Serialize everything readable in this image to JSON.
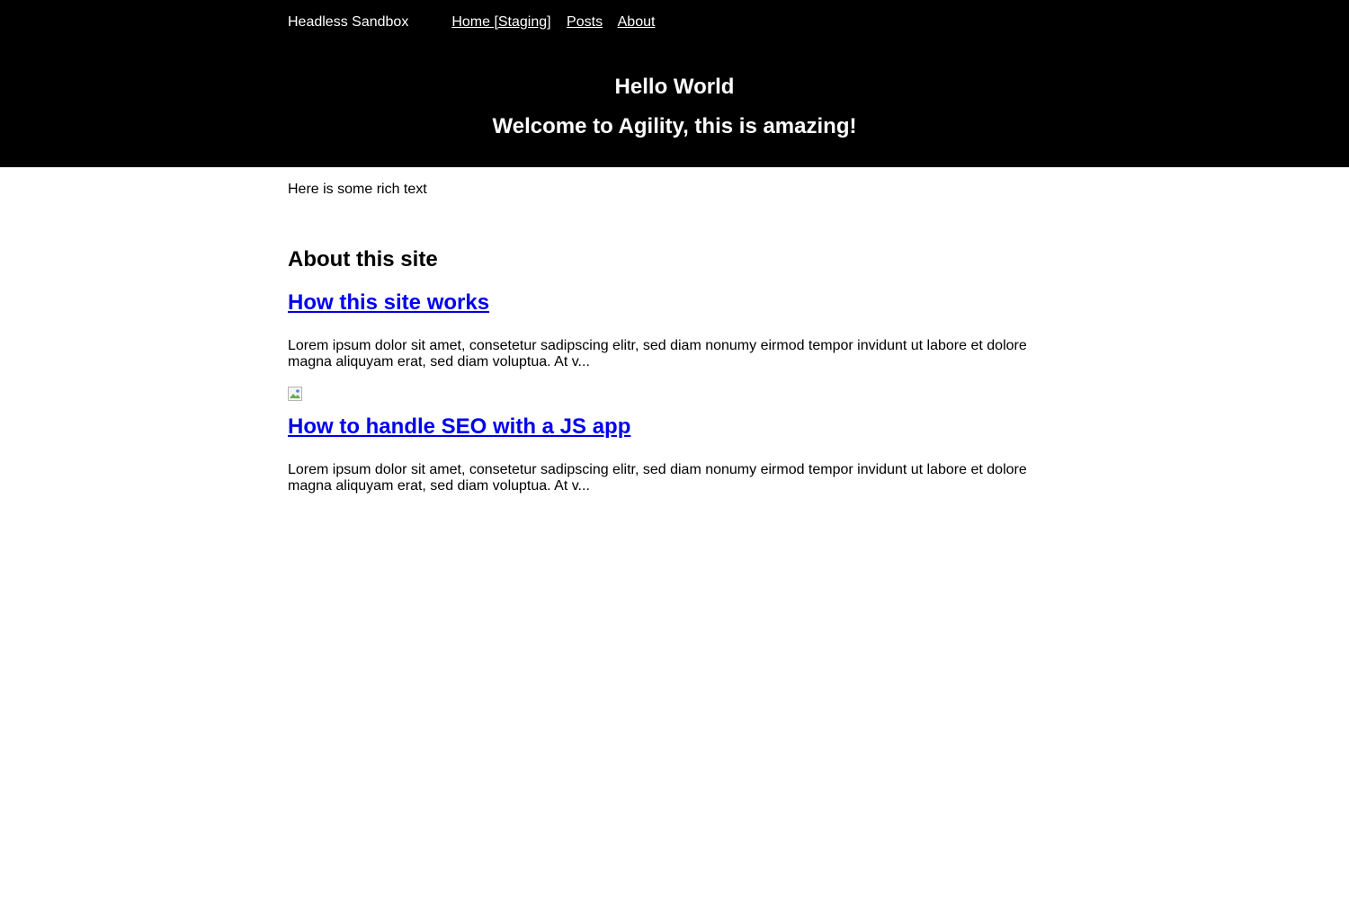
{
  "header": {
    "site_name": "Headless Sandbox",
    "nav": [
      "Home [Staging]",
      "Posts",
      "About"
    ]
  },
  "hero": {
    "title": "Hello World",
    "subtitle": "Welcome to Agility, this is amazing!"
  },
  "content": {
    "rich_text": "Here is some rich text",
    "section_title": "About this site",
    "posts": [
      {
        "title": "How this site works",
        "excerpt": "Lorem ipsum dolor sit amet, consetetur sadipscing elitr, sed diam nonumy eirmod tempor invidunt ut labore et dolore magna aliquyam erat, sed diam voluptua. At v..."
      },
      {
        "title": "How to handle SEO with a JS app",
        "excerpt": "Lorem ipsum dolor sit amet, consetetur sadipscing elitr, sed diam nonumy eirmod tempor invidunt ut labore et dolore magna aliquyam erat, sed diam voluptua. At v..."
      }
    ]
  }
}
